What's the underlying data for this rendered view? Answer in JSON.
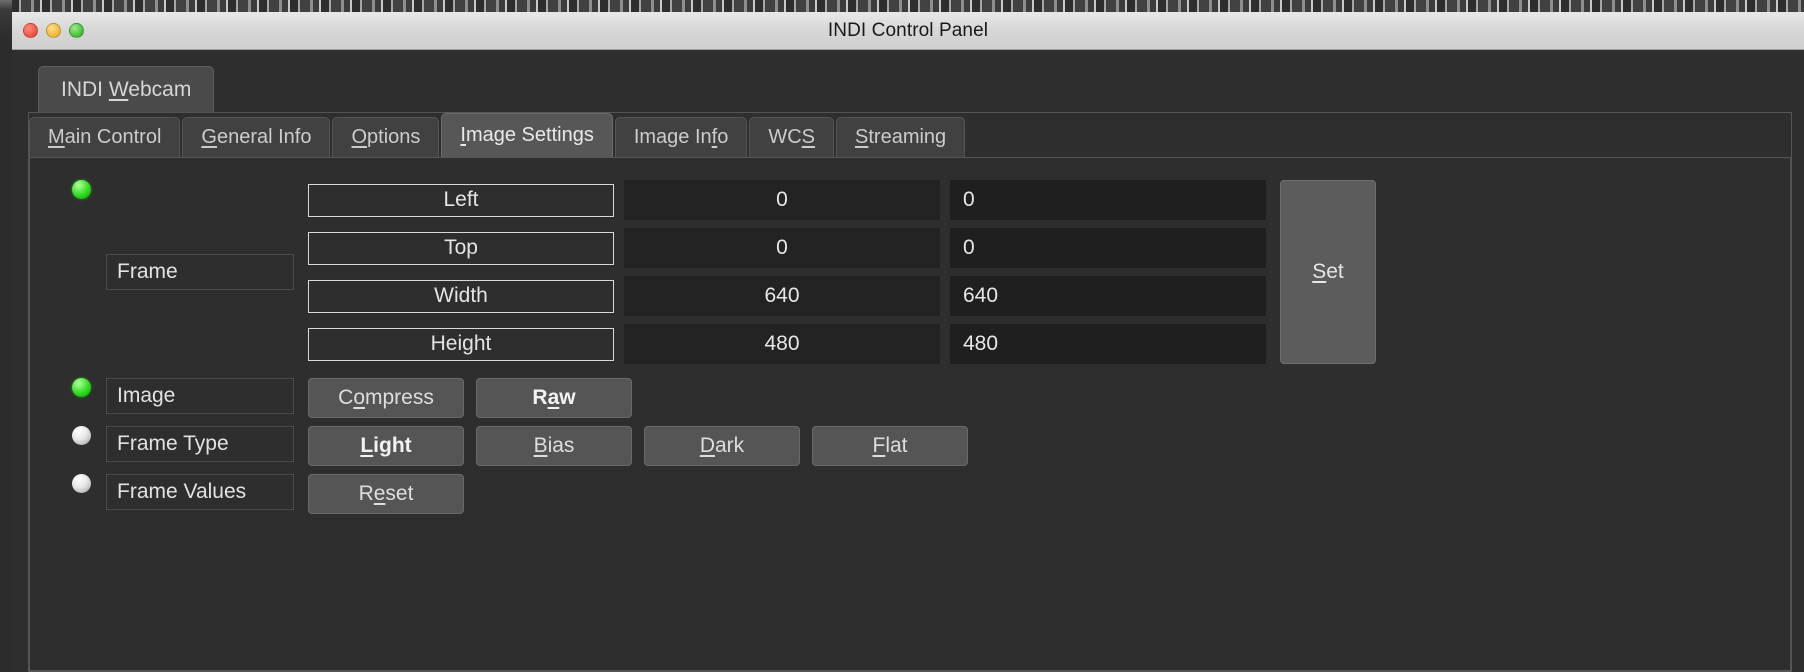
{
  "window": {
    "title": "INDI Control Panel",
    "traffic_lights": [
      "close",
      "minimize",
      "maximize"
    ]
  },
  "device_tabs": [
    {
      "label": "INDI Webcam",
      "accel": "W",
      "active": true
    }
  ],
  "property_tabs": [
    {
      "label": "Main Control",
      "accel": "M",
      "active": false
    },
    {
      "label": "General Info",
      "accel": "G",
      "active": false
    },
    {
      "label": "Options",
      "accel": "O",
      "active": false
    },
    {
      "label": "Image Settings",
      "accel": "I",
      "active": true
    },
    {
      "label": "Image Info",
      "accel": "f",
      "active": false
    },
    {
      "label": "WCS",
      "accel": "S",
      "active": false
    },
    {
      "label": "Streaming",
      "accel": "S",
      "active": false
    }
  ],
  "properties": [
    {
      "name": "Frame",
      "led": "ok",
      "type": "number",
      "set_button": {
        "label": "Set",
        "accel": "S"
      },
      "rows": [
        {
          "label": "Left",
          "value": "0",
          "target": "0"
        },
        {
          "label": "Top",
          "value": "0",
          "target": "0"
        },
        {
          "label": "Width",
          "value": "640",
          "target": "640"
        },
        {
          "label": "Height",
          "value": "480",
          "target": "480"
        }
      ]
    },
    {
      "name": "Image",
      "led": "ok",
      "type": "switch",
      "options": [
        {
          "label": "Compress",
          "accel": "o",
          "selected": false
        },
        {
          "label": "Raw",
          "accel": "a",
          "selected": true
        }
      ]
    },
    {
      "name": "Frame Type",
      "led": "idle",
      "type": "switch",
      "options": [
        {
          "label": "Light",
          "accel": "L",
          "selected": true
        },
        {
          "label": "Bias",
          "accel": "B",
          "selected": false
        },
        {
          "label": "Dark",
          "accel": "D",
          "selected": false
        },
        {
          "label": "Flat",
          "accel": "F",
          "selected": false
        }
      ]
    },
    {
      "name": "Frame Values",
      "led": "idle",
      "type": "switch",
      "options": [
        {
          "label": "Reset",
          "accel": "e",
          "selected": false
        }
      ]
    }
  ],
  "colors": {
    "led_on": "#2fd41f",
    "led_idle": "#dcdcdc",
    "window_bg": "#2e2e2e",
    "titlebar_bg": "#d8d8d8",
    "button_bg": "#555555",
    "active_tab_bg": "#575757"
  }
}
